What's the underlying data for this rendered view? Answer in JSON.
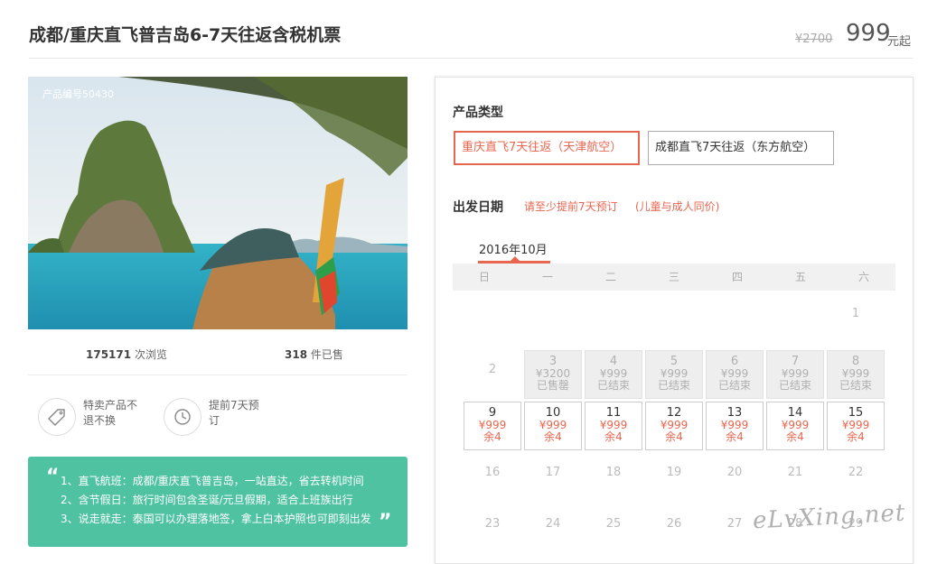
{
  "header": {
    "title": "成都/重庆直飞普吉岛6-7天往返含税机票",
    "price_old": "¥2700",
    "price_new": "999",
    "price_unit": "元起"
  },
  "product": {
    "code": "产品编号50430",
    "views_count": "175171",
    "views_label": "次浏览",
    "sold_count": "318",
    "sold_label": "件已售"
  },
  "features": [
    {
      "icon": "tag-icon",
      "label": "特卖产品不退不换"
    },
    {
      "icon": "clock-icon",
      "label": "提前7天预订"
    }
  ],
  "highlights": {
    "open_quote": "“",
    "close_quote": "”",
    "lines": [
      "1、直飞航班：成都/重庆直飞普吉岛，一站直达，省去转机时间",
      "2、含节假日：旅行时间包含圣诞/元旦假期，适合上班族出行",
      "3、说走就走：泰国可以办理落地签，拿上白本护照也可即刻出发"
    ]
  },
  "booking": {
    "type_title": "产品类型",
    "options": [
      "重庆直飞7天往返（天津航空）",
      "成都直飞7天往返（东方航空）"
    ],
    "date_title": "出发日期",
    "note1": "请至少提前7天预订",
    "note2": "(儿童与成人同价)",
    "month": "2016年10月",
    "weekdays": [
      "日",
      "一",
      "二",
      "三",
      "四",
      "五",
      "六"
    ],
    "days": [
      {
        "day": "1",
        "state": "plain"
      },
      {
        "day": "2",
        "state": "plain"
      },
      {
        "day": "3",
        "state": "past",
        "price": "¥3200",
        "status": "已售罄"
      },
      {
        "day": "4",
        "state": "past",
        "price": "¥999",
        "status": "已结束"
      },
      {
        "day": "5",
        "state": "past",
        "price": "¥999",
        "status": "已结束"
      },
      {
        "day": "6",
        "state": "past",
        "price": "¥999",
        "status": "已结束"
      },
      {
        "day": "7",
        "state": "past",
        "price": "¥999",
        "status": "已结束"
      },
      {
        "day": "8",
        "state": "past",
        "price": "¥999",
        "status": "已结束"
      },
      {
        "day": "9",
        "state": "avail",
        "price": "¥999",
        "status": "余4"
      },
      {
        "day": "10",
        "state": "avail",
        "price": "¥999",
        "status": "余4"
      },
      {
        "day": "11",
        "state": "avail",
        "price": "¥999",
        "status": "余4"
      },
      {
        "day": "12",
        "state": "avail",
        "price": "¥999",
        "status": "余4"
      },
      {
        "day": "13",
        "state": "avail",
        "price": "¥999",
        "status": "余4"
      },
      {
        "day": "14",
        "state": "avail",
        "price": "¥999",
        "status": "余4"
      },
      {
        "day": "15",
        "state": "avail",
        "price": "¥999",
        "status": "余4"
      },
      {
        "day": "16",
        "state": "plain"
      },
      {
        "day": "17",
        "state": "plain"
      },
      {
        "day": "18",
        "state": "plain"
      },
      {
        "day": "19",
        "state": "plain"
      },
      {
        "day": "20",
        "state": "plain"
      },
      {
        "day": "21",
        "state": "plain"
      },
      {
        "day": "22",
        "state": "plain"
      },
      {
        "day": "23",
        "state": "plain"
      },
      {
        "day": "24",
        "state": "plain"
      },
      {
        "day": "25",
        "state": "plain"
      },
      {
        "day": "26",
        "state": "plain"
      },
      {
        "day": "27",
        "state": "plain"
      },
      {
        "day": "28",
        "state": "plain"
      },
      {
        "day": "29",
        "state": "plain"
      }
    ]
  },
  "watermark": "eLvXing.net",
  "colors": {
    "accent": "#e8664f",
    "green": "#4fc3a1"
  }
}
